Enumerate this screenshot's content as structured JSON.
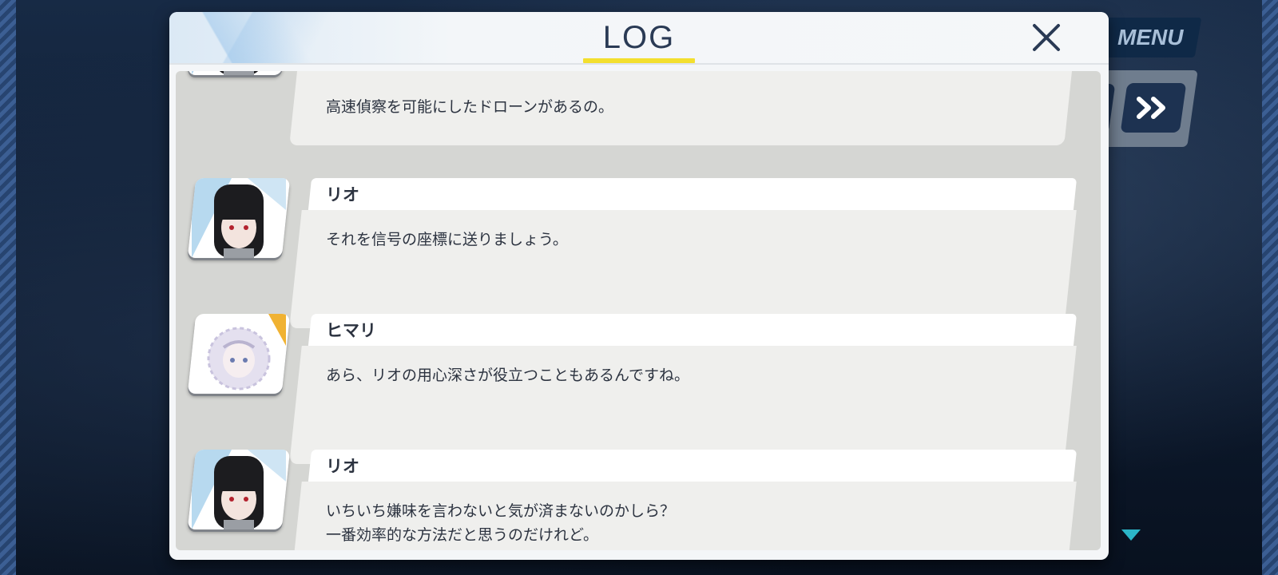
{
  "header": {
    "title": "LOG",
    "close_label": "close"
  },
  "hud": {
    "menu_label": "MENU"
  },
  "log": {
    "entries": [
      {
        "speaker": "",
        "lines": [
          "高速偵察を可能にしたドローンがあるの。"
        ],
        "portrait": "rio"
      },
      {
        "speaker": "リオ",
        "lines": [
          "それを信号の座標に送りましょう。"
        ],
        "portrait": "rio"
      },
      {
        "speaker": "ヒマリ",
        "lines": [
          "あら、リオの用心深さが役立つこともあるんですね。"
        ],
        "portrait": "himari"
      },
      {
        "speaker": "リオ",
        "lines": [
          "いちいち嫌味を言わないと気が済まないのかしら？",
          "一番効率的な方法だと思うのだけれど。"
        ],
        "portrait": "rio"
      }
    ]
  },
  "colors": {
    "accent_underline": "#f3df2e",
    "title_text": "#2a3a55",
    "scroll_arrow": "#2bb6c8"
  }
}
